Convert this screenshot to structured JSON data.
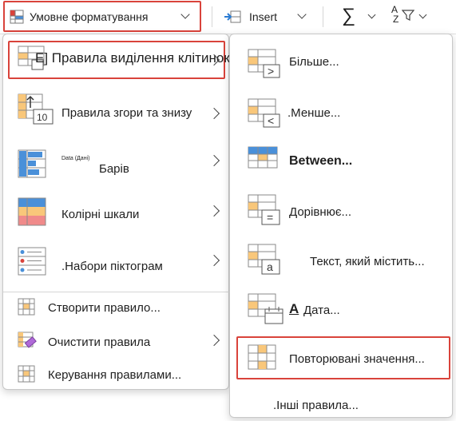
{
  "ribbon": {
    "conditional_formatting_label": "Умовне форматування",
    "insert_label": "Insert",
    "sum_symbol": "∑",
    "sort_az_top": "A",
    "sort_az_bottom": "Z"
  },
  "main_menu": {
    "items": [
      {
        "label": "Е] Правила виділення клітинок",
        "icon": "highlight-cells-icon"
      },
      {
        "label": "Правила згори та знизу",
        "icon": "top-bottom-icon",
        "icon_text": "10"
      },
      {
        "label": "Барів",
        "prefix": "Data (Дані)",
        "icon": "data-bars-icon"
      },
      {
        "label": "Колірні шкали",
        "icon": "color-scales-icon"
      },
      {
        "label": ".Набори піктограм",
        "icon": "icon-sets-icon"
      },
      {
        "label": "Створити правило...",
        "icon": "new-rule-icon"
      },
      {
        "label": "Очистити правила",
        "icon": "clear-rules-icon"
      },
      {
        "label": "Керування правилами...",
        "icon": "manage-rules-icon"
      }
    ]
  },
  "submenu": {
    "items": [
      {
        "label": "Більше...",
        "icon": "greater-than-icon",
        "symbol": ">"
      },
      {
        "label": ".Менше...",
        "icon": "less-than-icon",
        "symbol": "<"
      },
      {
        "label": "Between...",
        "icon": "between-icon"
      },
      {
        "label": "Дорівнює...",
        "icon": "equal-to-icon",
        "symbol": "="
      },
      {
        "label": "Текст, який містить...",
        "icon": "text-contains-icon",
        "symbol": "a"
      },
      {
        "label": "Дата...",
        "prefix": "A",
        "icon": "date-occurring-icon"
      },
      {
        "label": "Повторювані значення...",
        "icon": "duplicate-values-icon"
      },
      {
        "label": ".Інші правила...",
        "icon": ""
      }
    ]
  },
  "colors": {
    "highlight_border": "#d9433b",
    "cell_orange": "#f9c77a",
    "cell_blue": "#4a90d9",
    "cell_red": "#f08a8a",
    "grid_gray": "#8a8a8a"
  }
}
